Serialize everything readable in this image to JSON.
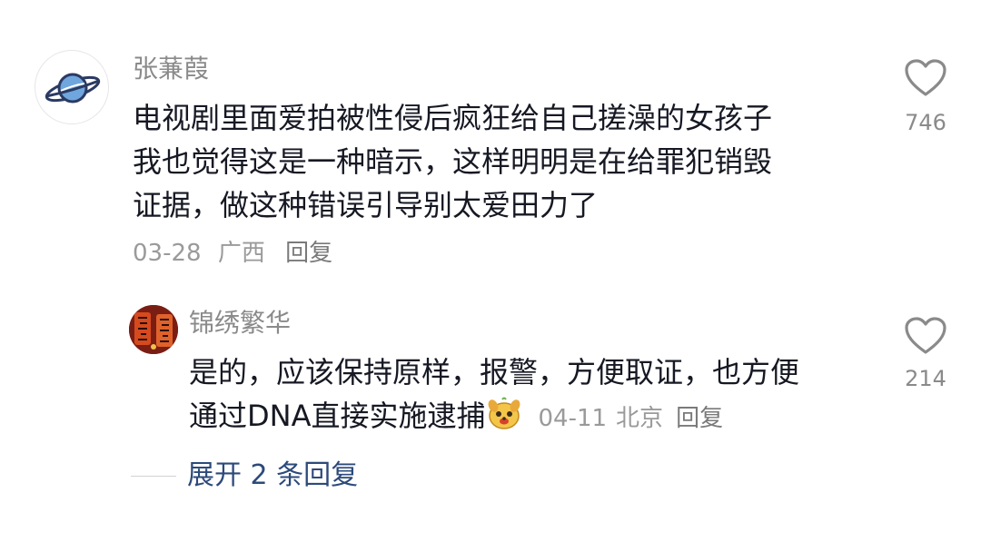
{
  "comment": {
    "username": "张蒹葭",
    "text_lines": [
      "电视剧里面爱拍被性侵后疯狂给自己搓澡的女孩子",
      "我也觉得这是一种暗示，这样明明是在给罪犯销毁",
      "证据，做这种错误引导别太爱田力了"
    ],
    "date": "03-28",
    "location": "广西",
    "reply_label": "回复",
    "like_count": "746",
    "avatar_icon": "planet-icon"
  },
  "reply": {
    "username": "锦绣繁华",
    "text_lines": [
      "是的，应该保持原样，报警，方便取证，也方便",
      "通过DNA直接实施逮捕"
    ],
    "emoji_icon": "dog-face-emoji",
    "date": "04-11",
    "location": "北京",
    "reply_label": "回复",
    "like_count": "214"
  },
  "expand": {
    "label": "展开 2 条回复"
  },
  "colors": {
    "text": "#161823",
    "muted": "#8a8a8a",
    "link_blue": "#2c4a7a"
  }
}
